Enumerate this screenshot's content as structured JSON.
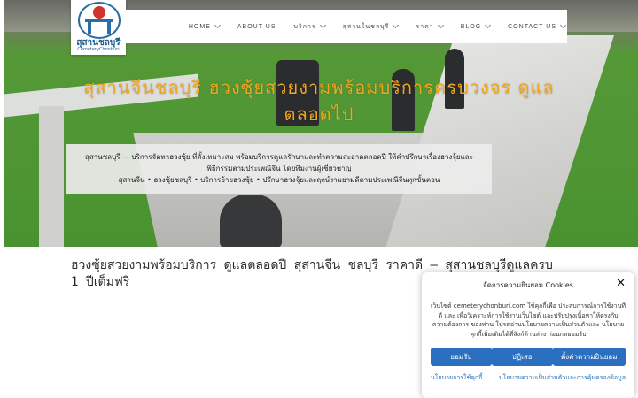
{
  "logo": {
    "name": "สุสานชลบุรี",
    "subtitle": "CemeteryChonburi"
  },
  "nav": {
    "items": [
      {
        "label": "HOME",
        "dropdown": true
      },
      {
        "label": "ABOUT US",
        "dropdown": false
      },
      {
        "label": "บริการ",
        "dropdown": true
      },
      {
        "label": "สุสานในชลบุรี",
        "dropdown": true
      },
      {
        "label": "ราคา",
        "dropdown": true
      },
      {
        "label": "BLOG",
        "dropdown": true
      },
      {
        "label": "CONTACT US",
        "dropdown": true
      }
    ]
  },
  "hero": {
    "title": "สุสานจีนชลบุรี ฮวงซุ้ยสวยงามพร้อมบริการครบวงจร ดูแลตลอดไป",
    "caption_line1": "สุสานชลบุรี — บริการจัดหาฮวงซุ้ย ที่ตั้งเหมาะสม พร้อมบริการดูแลรักษาและทำความสะอาดตลอดปี ให้คำปรึกษาเรื่องฮวงจุ้ยและพิธีกรรมตามประเพณีจีน โดยทีมงานผู้เชี่ยวชาญ",
    "caption_line2": "สุสานจีน • ฮวงซุ้ยชลบุรี • บริการย้ายฮวงซุ้ย • ปรึกษาฮวงจุ้ยและฤกษ์งามยามดีตามประเพณีจีนทุกขั้นตอน"
  },
  "post": {
    "title": "ฮวงซุ้ยสวยงามพร้อมบริการ ดูแลตลอดปี สุสานจีน ชลบุรี ราคาดี – สุสานชลบุรีดูแลครบ 1 ปีเต็มฟรี"
  },
  "cookie": {
    "title": "จัดการความยินยอม Cookies",
    "body": "เว็บไซต์ cemeterychonburi.com ใช้คุกกี้เพื่อ ประสบการณ์การใช้งานที่ดี และ เพื่อวิเคราะห์การใช้งานเว็บไซต์ และปรับปรุงเนื้อหาให้ตรงกับความต้องการ ของท่าน โปรดอ่านนโยบายความเป็นส่วนตัวและ นโยบายคุกกี้เพิ่มเติมได้ที่ลิงก์ด้านล่าง ก่อนกดยอมรับ",
    "accept_label": "ยอมรับ",
    "deny_label": "ปฏิเสธ",
    "preferences_label": "ตั้งค่าความยินยอม",
    "link_cookie_policy": "นโยบายการใช้คุกกี้",
    "link_privacy_policy": "นโยบายความเป็นส่วนตัวและการคุ้มครองข้อมูล"
  },
  "colors": {
    "hero_title": "#f0a51e",
    "button_blue": "#2a6fc0",
    "logo_blue": "#1b5a8e"
  }
}
